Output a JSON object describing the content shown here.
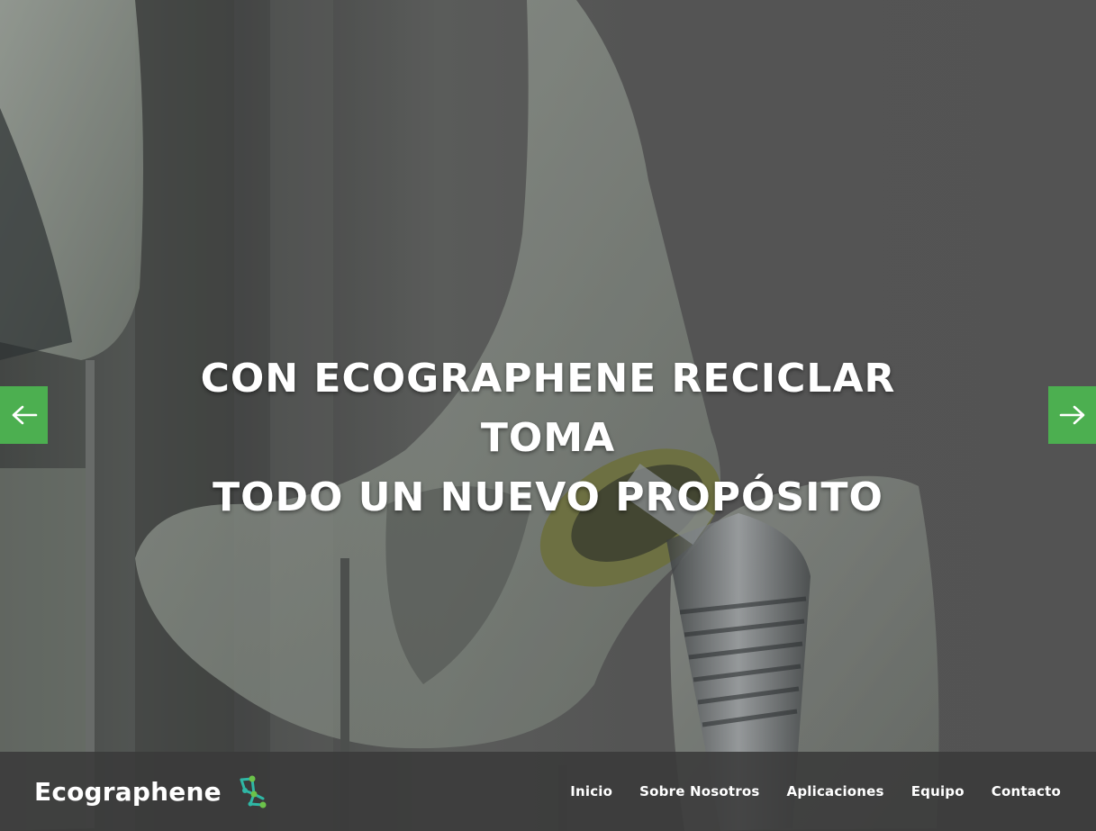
{
  "hero": {
    "headline_line1": "CON ECOGRAPHENE RECICLAR TOMA",
    "headline_line2": "TODO UN NUEVO PROPÓSITO",
    "prev_icon": "arrow-left-icon",
    "next_icon": "arrow-right-icon"
  },
  "navbar": {
    "brand": "Ecographene",
    "logo_icon": "molecule-logo-icon",
    "menu": [
      {
        "label": "Inicio"
      },
      {
        "label": "Sobre Nosotros"
      },
      {
        "label": "Aplicaciones"
      },
      {
        "label": "Equipo"
      },
      {
        "label": "Contacto"
      }
    ]
  },
  "colors": {
    "accent": "#4caf50",
    "navbar_bg": "#3a3a3a",
    "text": "#ffffff",
    "logo_teal": "#2fb7a5",
    "logo_green": "#6cc24a"
  }
}
